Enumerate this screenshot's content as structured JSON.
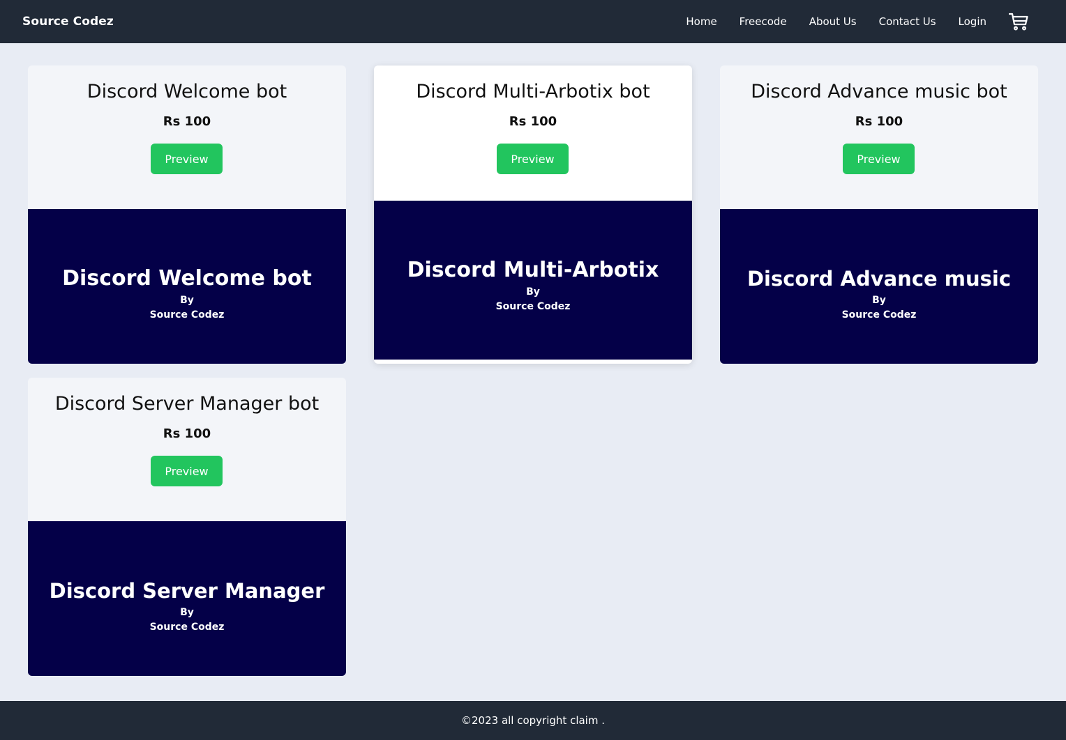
{
  "navbar": {
    "brand": "Source Codez",
    "links": [
      "Home",
      "Freecode",
      "About Us",
      "Contact Us",
      "Login"
    ],
    "cart_icon": "shopping-cart-icon"
  },
  "products": [
    {
      "title": "Discord Welcome bot",
      "price": "Rs 100",
      "button": "Preview",
      "banner_title": "Discord Welcome bot",
      "banner_by": "By",
      "banner_author": "Source Codez"
    },
    {
      "title": "Discord Multi-Arbotix bot",
      "price": "Rs 100",
      "button": "Preview",
      "banner_title": "Discord Multi-Arbotix",
      "banner_by": "By",
      "banner_author": "Source Codez"
    },
    {
      "title": "Discord Advance music bot",
      "price": "Rs 100",
      "button": "Preview",
      "banner_title": "Discord Advance music",
      "banner_by": "By",
      "banner_author": "Source Codez"
    },
    {
      "title": "Discord Server Manager bot",
      "price": "Rs 100",
      "button": "Preview",
      "banner_title": "Discord Server Manager",
      "banner_by": "By",
      "banner_author": "Source Codez"
    }
  ],
  "footer": {
    "text": "©2023 all copyright claim ."
  },
  "colors": {
    "nav_bg": "#212a37",
    "page_bg": "#e8ecf4",
    "card_bg": "#f3f5f9",
    "button_green": "#22c55e",
    "banner_navy": "#040048"
  }
}
